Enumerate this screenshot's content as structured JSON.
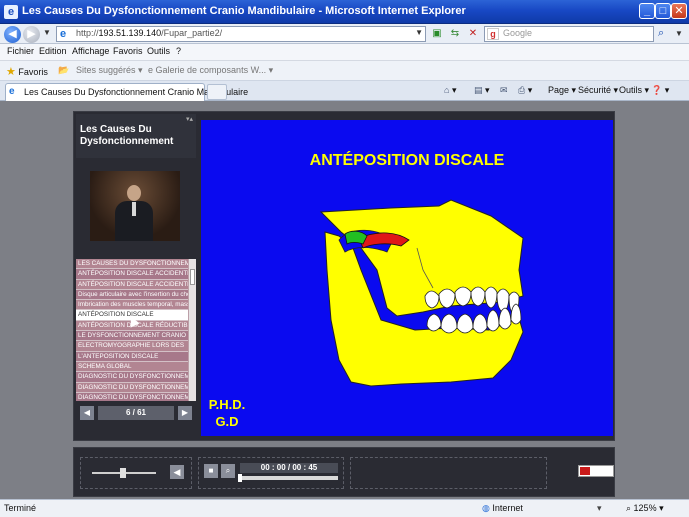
{
  "window": {
    "title": "Les Causes Du Dysfonctionnement Cranio Mandibulaire - Microsoft Internet Explorer",
    "min": "_",
    "max": "□",
    "close": "✕"
  },
  "address": {
    "url_host": "193.51.139.140",
    "url_rest": "/Fupar_partie2/",
    "url_prefix": "http://",
    "search_placeholder": "Google"
  },
  "menu": [
    "Fichier",
    "Edition",
    "Affichage",
    "Favoris",
    "Outils",
    "?"
  ],
  "favorites": {
    "label": "Favoris",
    "suggested": "Sites suggérés",
    "gallery": "Galerie de composants W..."
  },
  "tab": {
    "label": "Les Causes Du Dysfonctionnement Cranio Mandibulaire"
  },
  "tools": {
    "page": "Page",
    "security": "Sécurité",
    "tools": "Outils"
  },
  "player": {
    "course_title_line1": "Les Causes Du",
    "course_title_line2": "Dysfonctionnement",
    "chapters": [
      "LES CAUSES DU DYSFONCTIONNEMENT",
      "ANTÉPOSITION DISCALE ACCIDENTELLE",
      "ANTÉPOSITION DISCALE ACCIDENTELLE",
      "Disque articulaire avec l'insertion du chef",
      "Imbrication des muscles temporal, masséter",
      "ANTÉPOSITION DISCALE",
      "ANTÉPOSITION DISCALE RÉDUCTIBLE",
      "LE DYSFONCTIONNEMENT CRANIO",
      "ELECTROMYOGRAPHIE LORS DES",
      "L'ANTEPOSITION DISCALE",
      "SCHEMA GLOBAL",
      "DIAGNOSTIC DU DYSFONCTIONNEMENT",
      "DIAGNOSTIC DU DYSFONCTIONNEMENT",
      "DIAGNOSTIC DU DYSFONCTIONNEMENT"
    ],
    "active_chapter": 5,
    "page_count": "6 / 61",
    "time": "00 : 00 / 00 : 45",
    "progress": 0.02
  },
  "slide": {
    "title": "ANTÉPOSITION DISCALE",
    "credit_line1": "P.H.D.",
    "credit_line2": "G.D",
    "colors": {
      "background": "#0a0af0",
      "text": "#ffff00",
      "bone": "#ffff00",
      "disc_red": "#e01818",
      "disc_green": "#22c022"
    }
  },
  "status": {
    "text": "Terminé",
    "zone": "Internet",
    "zoom": "125%"
  }
}
